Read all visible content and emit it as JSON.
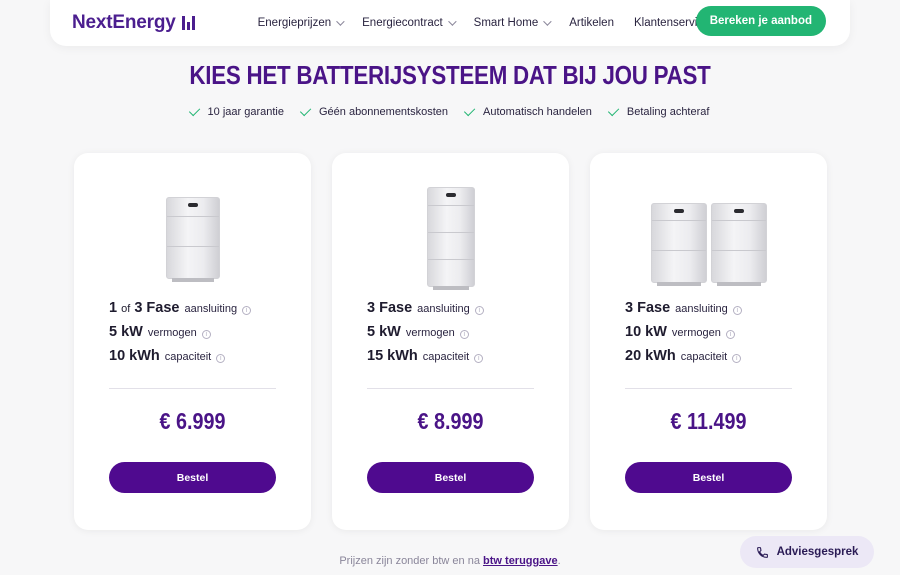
{
  "nav": {
    "logo": "NextEnergy",
    "links": [
      {
        "label": "Energieprijzen",
        "dropdown": true
      },
      {
        "label": "Energiecontract",
        "dropdown": true
      },
      {
        "label": "Smart Home",
        "dropdown": true
      },
      {
        "label": "Artikelen",
        "dropdown": false
      },
      {
        "label": "Klantenservice",
        "dropdown": false
      }
    ],
    "cta": "Bereken je aanbod"
  },
  "heading": "KIES HET BATTERIJSYSTEEM DAT BIJ JOU PAST",
  "usps": [
    "10 jaar garantie",
    "Géén abonnementskosten",
    "Automatisch handelen",
    "Betaling achteraf"
  ],
  "cards": [
    {
      "specs": [
        {
          "value": "1",
          "value_small": "of",
          "value_tail": "3 Fase",
          "label": "aansluiting"
        },
        {
          "value": "5 kW",
          "label": "vermogen"
        },
        {
          "value": "10 kWh",
          "label": "capaciteit"
        }
      ],
      "price": "€ 6.999",
      "button": "Bestel"
    },
    {
      "specs": [
        {
          "value": "3 Fase",
          "label": "aansluiting"
        },
        {
          "value": "5 kW",
          "label": "vermogen"
        },
        {
          "value": "15 kWh",
          "label": "capaciteit"
        }
      ],
      "price": "€ 8.999",
      "button": "Bestel"
    },
    {
      "specs": [
        {
          "value": "3 Fase",
          "label": "aansluiting"
        },
        {
          "value": "10 kW",
          "label": "vermogen"
        },
        {
          "value": "20 kWh",
          "label": "capaciteit"
        }
      ],
      "price": "€ 11.499",
      "button": "Bestel"
    }
  ],
  "footnote": {
    "text": "Prijzen zijn zonder btw en na",
    "link": "btw teruggave",
    "suffix": "."
  },
  "advies_button": "Adviesgesprek",
  "colors": {
    "brand": "#4a1487",
    "accent": "#22b573",
    "button": "#4f0a8f"
  }
}
